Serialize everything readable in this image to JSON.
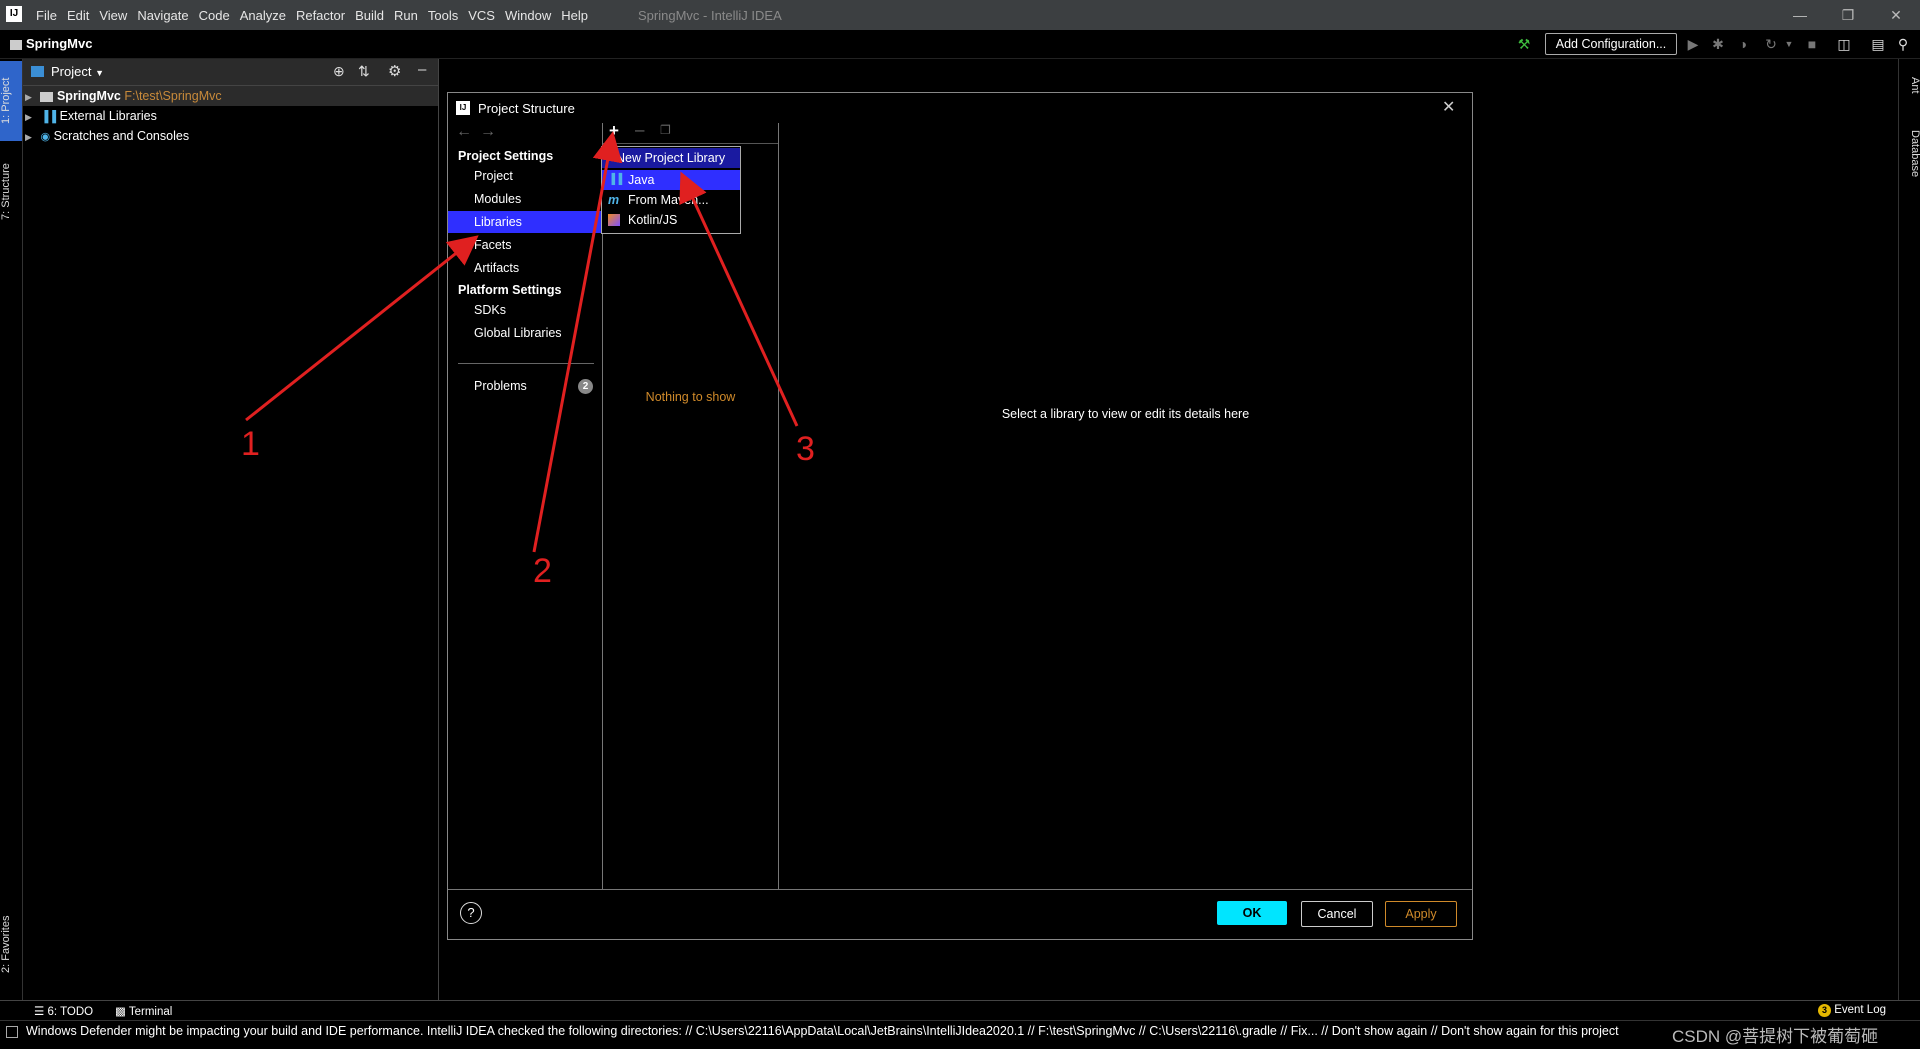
{
  "titlebar": {
    "logo": "IJ",
    "menu": [
      "File",
      "Edit",
      "View",
      "Navigate",
      "Code",
      "Analyze",
      "Refactor",
      "Build",
      "Run",
      "Tools",
      "VCS",
      "Window",
      "Help"
    ],
    "window_title": "SpringMvc - IntelliJ IDEA"
  },
  "navbar": {
    "project": "SpringMvc",
    "add_configuration": "Add Configuration..."
  },
  "left_stripe": {
    "project_tab": "1: Project",
    "structure_tab": "7: Structure",
    "favorites_tab": "2: Favorites"
  },
  "right_stripe": {
    "ant_tab": "Ant",
    "database_tab": "Database"
  },
  "project_panel": {
    "title": "Project",
    "tree": [
      {
        "label": "SpringMvc",
        "path": "F:\\test\\SpringMvc"
      },
      {
        "label": "External Libraries"
      },
      {
        "label": "Scratches and Consoles"
      }
    ]
  },
  "dialog": {
    "title": "Project Structure",
    "project_settings_header": "Project Settings",
    "project_settings": [
      "Project",
      "Modules",
      "Libraries",
      "Facets",
      "Artifacts"
    ],
    "platform_settings_header": "Platform Settings",
    "platform_settings": [
      "SDKs",
      "Global Libraries"
    ],
    "problems_label": "Problems",
    "problems_count": "2",
    "nothing_to_show": "Nothing to show",
    "detail_hint": "Select a library to view or edit its details here",
    "help": "?",
    "ok": "OK",
    "cancel": "Cancel",
    "apply": "Apply"
  },
  "popup": {
    "header": "New Project Library",
    "items": [
      "Java",
      "From Maven...",
      "Kotlin/JS"
    ]
  },
  "annotations": [
    "1",
    "2",
    "3"
  ],
  "bottom_tabs": {
    "todo": "6: TODO",
    "terminal": "Terminal",
    "event_log": "Event Log",
    "event_count": "3"
  },
  "status": {
    "message": "Windows Defender might be impacting your build and IDE performance. IntelliJ IDEA checked the following directories: // C:\\Users\\22116\\AppData\\Local\\JetBrains\\IntelliJIdea2020.1 // F:\\test\\SpringMvc // C:\\Users\\22116\\.gradle // Fix... // Don't show again // Don't show again for this project",
    "watermark": "CSDN @菩提树下被葡萄砸"
  },
  "colors": {
    "selection": "#2f2fff",
    "ok_button": "#00e5ff",
    "apply_text": "#d08a2a",
    "path_text": "#c88a3a",
    "annotation": "#e02020"
  }
}
